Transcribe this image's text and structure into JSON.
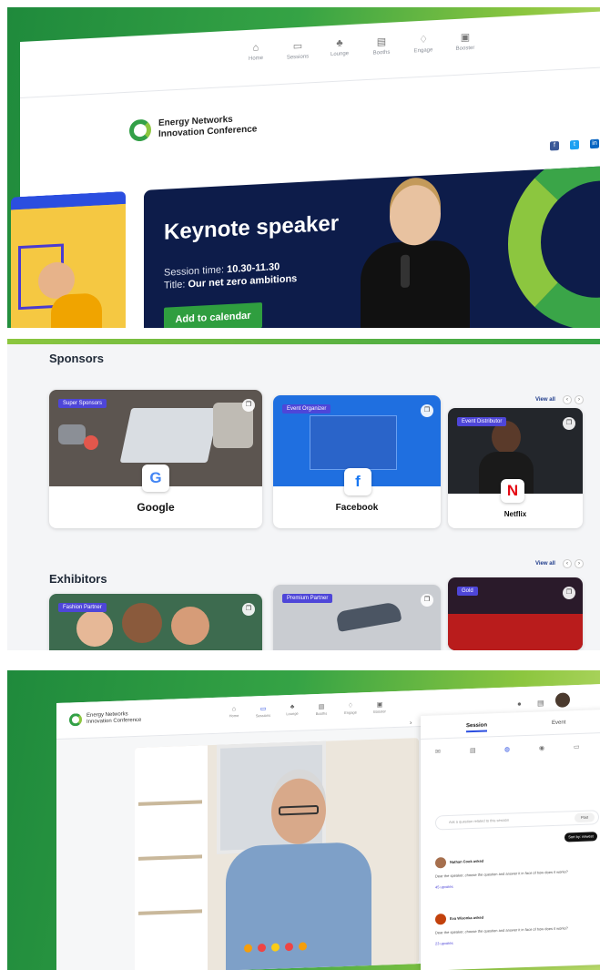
{
  "nav": {
    "items": [
      {
        "label": "Home",
        "icon": "home-icon",
        "glyph": "⌂"
      },
      {
        "label": "Sessions",
        "icon": "video-icon",
        "glyph": "▭"
      },
      {
        "label": "Lounge",
        "icon": "lounge-icon",
        "glyph": "♣"
      },
      {
        "label": "Booths",
        "icon": "booth-icon",
        "glyph": "▤"
      },
      {
        "label": "Engage",
        "icon": "engage-icon",
        "glyph": "♢"
      },
      {
        "label": "Booster",
        "icon": "booster-icon",
        "glyph": "▣"
      }
    ]
  },
  "brand": {
    "line1": "Energy Networks",
    "line2": "Innovation Conference"
  },
  "socials": [
    "f",
    "t",
    "in"
  ],
  "hero": {
    "title": "Keynote speaker",
    "time_label": "Session time:",
    "time_value": "10.30-11.30",
    "title_label": "Title:",
    "title_value": "Our net zero ambitions",
    "cta": "Add to calendar"
  },
  "sponsors": {
    "heading": "Sponsors",
    "view_all": "View all",
    "cards": [
      {
        "badge": "Super Sponsors",
        "name": "Google",
        "logo": "G",
        "logo_color": "#4285f4"
      },
      {
        "badge": "Event Organizer",
        "name": "Facebook",
        "logo": "f",
        "logo_color": "#1877f2"
      },
      {
        "badge": "Event Distributor",
        "name": "Netflix",
        "logo": "N",
        "logo_color": "#e50914"
      }
    ]
  },
  "exhibitors": {
    "heading": "Exhibitors",
    "view_all": "View all",
    "cards": [
      {
        "badge": "Fashion Partner"
      },
      {
        "badge": "Premium Partner"
      },
      {
        "badge": "Gold"
      }
    ]
  },
  "session": {
    "tabs": [
      "Session",
      "Event"
    ],
    "icons": [
      "✉",
      "▤",
      "◍",
      "◉",
      "▭"
    ],
    "ask_placeholder": "Ask a question related to this session",
    "ask_button": "Post",
    "sort": "Sort by: newest",
    "questions": [
      {
        "name": "Nathan Cook asked",
        "text": "Dear the speaker, choose the question and answer it in face of how does it works?",
        "votes": "45 upvotes"
      },
      {
        "name": "Eva Wisonka asked",
        "text": "Dear the speaker, choose the question and answer it in face of how does it works?",
        "votes": "23 upvotes"
      }
    ]
  },
  "colors": {
    "green": "#35a345",
    "navy": "#0d1c4a",
    "accent": "#4e46d8"
  }
}
